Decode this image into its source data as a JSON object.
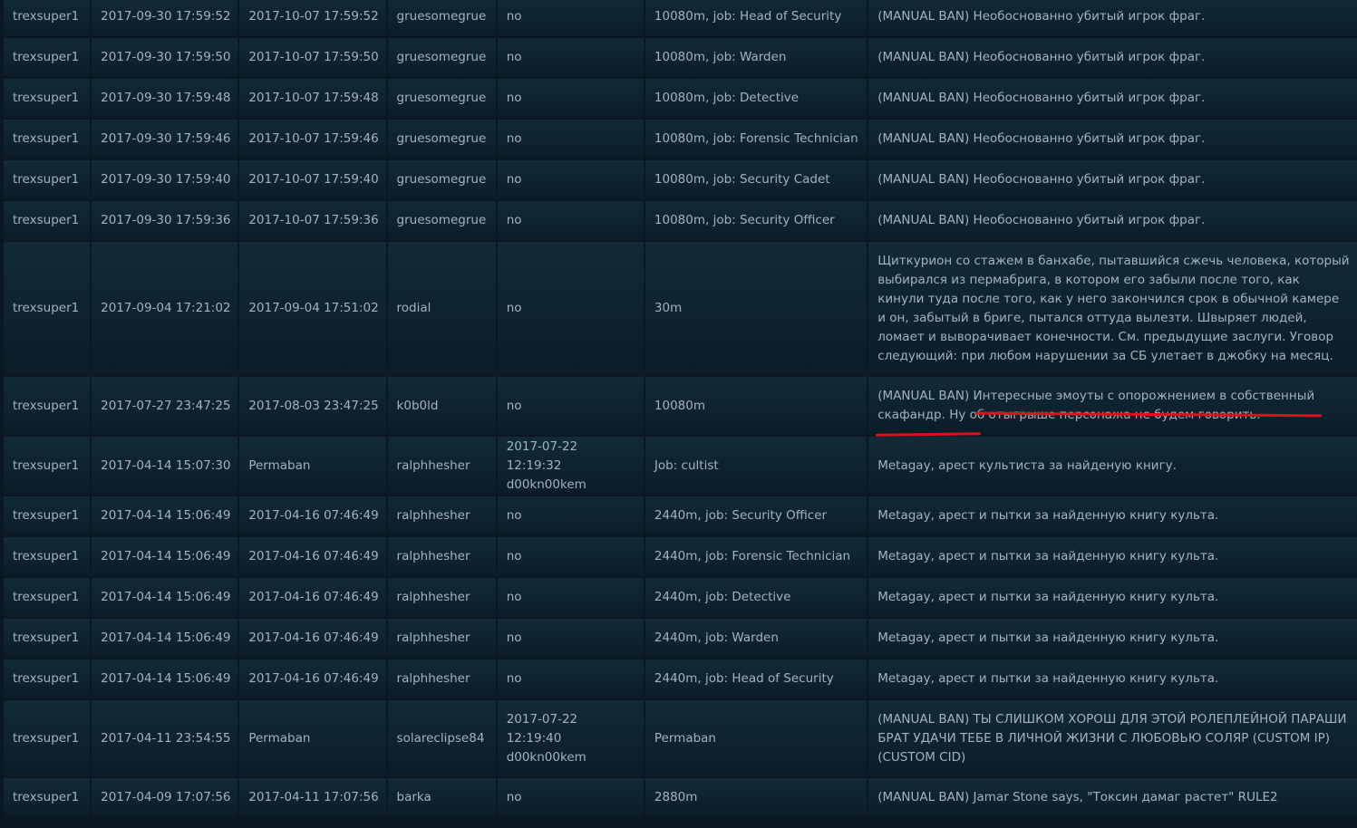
{
  "rows": [
    {
      "admin": "trexsuper1",
      "date": "2017-09-30 17:59:52",
      "expires": "2017-10-07 17:59:52",
      "target": "gruesomegrue",
      "unbanned": "no",
      "length": "10080m, job: Head of Security",
      "reason": "(MANUAL BAN) Необоснованно убитый игрок фраг."
    },
    {
      "admin": "trexsuper1",
      "date": "2017-09-30 17:59:50",
      "expires": "2017-10-07 17:59:50",
      "target": "gruesomegrue",
      "unbanned": "no",
      "length": "10080m, job: Warden",
      "reason": "(MANUAL BAN) Необоснованно убитый игрок фраг."
    },
    {
      "admin": "trexsuper1",
      "date": "2017-09-30 17:59:48",
      "expires": "2017-10-07 17:59:48",
      "target": "gruesomegrue",
      "unbanned": "no",
      "length": "10080m, job: Detective",
      "reason": "(MANUAL BAN) Необоснованно убитый игрок фраг."
    },
    {
      "admin": "trexsuper1",
      "date": "2017-09-30 17:59:46",
      "expires": "2017-10-07 17:59:46",
      "target": "gruesomegrue",
      "unbanned": "no",
      "length": "10080m, job: Forensic Technician",
      "reason": "(MANUAL BAN) Необоснованно убитый игрок фраг."
    },
    {
      "admin": "trexsuper1",
      "date": "2017-09-30 17:59:40",
      "expires": "2017-10-07 17:59:40",
      "target": "gruesomegrue",
      "unbanned": "no",
      "length": "10080m, job: Security Cadet",
      "reason": "(MANUAL BAN) Необоснованно убитый игрок фраг."
    },
    {
      "admin": "trexsuper1",
      "date": "2017-09-30 17:59:36",
      "expires": "2017-10-07 17:59:36",
      "target": "gruesomegrue",
      "unbanned": "no",
      "length": "10080m, job: Security Officer",
      "reason": "(MANUAL BAN) Необоснованно убитый игрок фраг."
    },
    {
      "admin": "trexsuper1",
      "date": "2017-09-04 17:21:02",
      "expires": "2017-09-04 17:51:02",
      "target": "rodial",
      "unbanned": "no",
      "length": "30m",
      "reason": "Щиткурион со стажем в банхабе, пытавшийся сжечь человека, который выбирался из пермабрига, в котором его забыли после того, как кинули туда после того, как у него закончился срок в обычной камере и он, забытый в бриге, пытался оттуда вылезти. Швыряет людей, ломает и выворачивает конечности. См. предыдущие заслуги. Уговор следующий: при любом нарушении за СБ улетает в джобку на месяц."
    },
    {
      "admin": "trexsuper1",
      "date": "2017-07-27 23:47:25",
      "expires": "2017-08-03 23:47:25",
      "target": "k0b0ld",
      "unbanned": "no",
      "length": "10080m",
      "reason": "(MANUAL BAN) Интересные эмоуты с опорожнением в собственный скафандр. Ну об отыгрыше персонажа не будем говорить."
    },
    {
      "admin": "trexsuper1",
      "date": "2017-04-14 15:07:30",
      "expires": "Permaban",
      "target": "ralphhesher",
      "unbanned": "2017-07-22 12:19:32 d00kn00kem",
      "length": "Job: cultist",
      "reason": "Metagay, арест культиста за найденую книгу."
    },
    {
      "admin": "trexsuper1",
      "date": "2017-04-14 15:06:49",
      "expires": "2017-04-16 07:46:49",
      "target": "ralphhesher",
      "unbanned": "no",
      "length": "2440m, job: Security Officer",
      "reason": "Metagay, арест и пытки за найденную книгу культа."
    },
    {
      "admin": "trexsuper1",
      "date": "2017-04-14 15:06:49",
      "expires": "2017-04-16 07:46:49",
      "target": "ralphhesher",
      "unbanned": "no",
      "length": "2440m, job: Forensic Technician",
      "reason": "Metagay, арест и пытки за найденную книгу культа."
    },
    {
      "admin": "trexsuper1",
      "date": "2017-04-14 15:06:49",
      "expires": "2017-04-16 07:46:49",
      "target": "ralphhesher",
      "unbanned": "no",
      "length": "2440m, job: Detective",
      "reason": "Metagay, арест и пытки за найденную книгу культа."
    },
    {
      "admin": "trexsuper1",
      "date": "2017-04-14 15:06:49",
      "expires": "2017-04-16 07:46:49",
      "target": "ralphhesher",
      "unbanned": "no",
      "length": "2440m, job: Warden",
      "reason": "Metagay, арест и пытки за найденную книгу культа."
    },
    {
      "admin": "trexsuper1",
      "date": "2017-04-14 15:06:49",
      "expires": "2017-04-16 07:46:49",
      "target": "ralphhesher",
      "unbanned": "no",
      "length": "2440m, job: Head of Security",
      "reason": "Metagay, арест и пытки за найденную книгу культа."
    },
    {
      "admin": "trexsuper1",
      "date": "2017-04-11 23:54:55",
      "expires": "Permaban",
      "target": "solareclipse84",
      "unbanned": "2017-07-22 12:19:40 d00kn00kem",
      "length": "Permaban",
      "reason": "(MANUAL BAN) ТЫ СЛИШКОМ ХОРОШ ДЛЯ ЭТОЙ РОЛЕПЛЕЙНОЙ ПАРАШИ БРАТ УДАЧИ ТЕБЕ В ЛИЧНОЙ ЖИЗНИ С ЛЮБОВЬЮ СОЛЯР (CUSTOM IP) (CUSTOM CID)"
    },
    {
      "admin": "trexsuper1",
      "date": "2017-04-09 17:07:56",
      "expires": "2017-04-11 17:07:56",
      "target": "barka",
      "unbanned": "no",
      "length": "2880m",
      "reason": "(MANUAL BAN) Jamar Stone says, \"Токсин дамаг растет\" RULE2"
    }
  ],
  "colors": {
    "background": "#0b1822",
    "cell": "#0f2432",
    "text": "#a3b3bd",
    "annotation": "#e0101a"
  }
}
